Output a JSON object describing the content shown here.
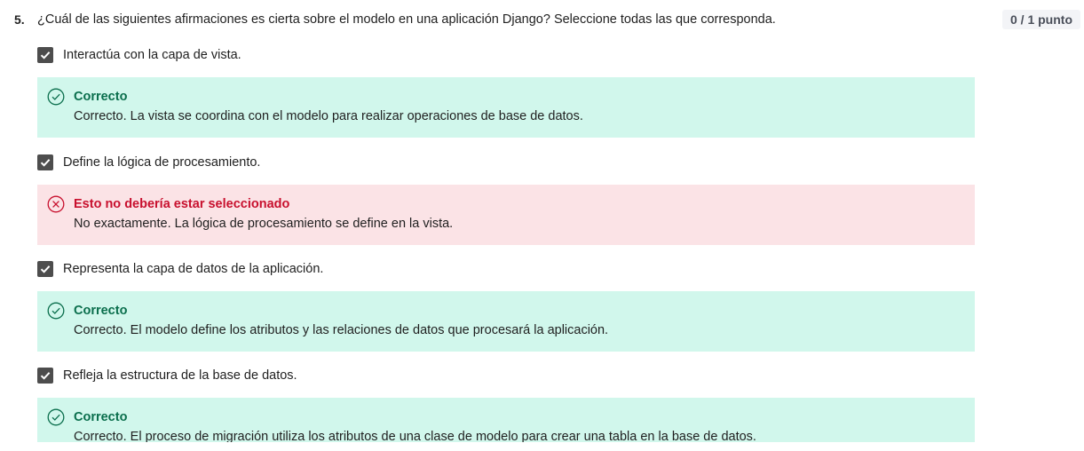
{
  "question": {
    "number": "5.",
    "text": "¿Cuál de las siguientes afirmaciones es cierta sobre el modelo en una aplicación Django? Seleccione todas las que corresponda.",
    "score": "0 / 1 punto"
  },
  "options": [
    {
      "label": "Interactúa con la capa de vista.",
      "checked": true,
      "feedback": {
        "status": "correct",
        "title": "Correcto",
        "text": "Correcto. La vista se coordina con el modelo para realizar operaciones de base de datos."
      }
    },
    {
      "label": "Define la lógica de procesamiento.",
      "checked": true,
      "feedback": {
        "status": "wrong",
        "title": "Esto no debería estar seleccionado",
        "text": "No exactamente. La lógica de procesamiento se define en la vista."
      }
    },
    {
      "label": "Representa la capa de datos de la aplicación.",
      "checked": true,
      "feedback": {
        "status": "correct",
        "title": "Correcto",
        "text": "Correcto. El modelo define los atributos y las relaciones de datos que procesará la aplicación."
      }
    },
    {
      "label": "Refleja la estructura de la base de datos.",
      "checked": true,
      "feedback": {
        "status": "correct",
        "title": "Correcto",
        "text": "Correcto. El proceso de migración utiliza los atributos de una clase de modelo para crear una tabla en la base de datos."
      }
    }
  ],
  "icons": {
    "checkbox": "checkmark-icon",
    "correct": "check-circle-icon",
    "wrong": "x-circle-icon"
  },
  "colors": {
    "correct_bg": "#d1f7ec",
    "correct_text": "#0a6e4c",
    "wrong_bg": "#fbe3e6",
    "wrong_text": "#c8102e",
    "checkbox": "#4d4d4d"
  }
}
